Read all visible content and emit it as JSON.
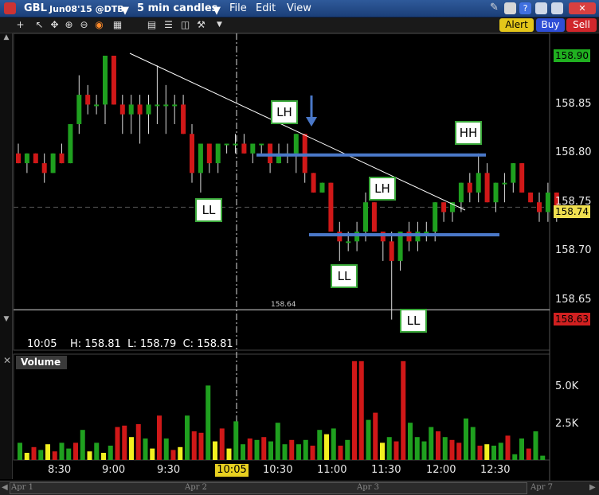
{
  "titlebar": {
    "symbol": "GBL",
    "contract": "Jun08'15 @DTB",
    "interval": "5 min candles",
    "menus": [
      "File",
      "Edit",
      "View"
    ]
  },
  "toolbar": {
    "alert_label": "Alert",
    "buy_label": "Buy",
    "sell_label": "Sell"
  },
  "price_axis": {
    "labels": [
      "158.90",
      "158.85",
      "158.80",
      "158.75",
      "158.70",
      "158.65"
    ],
    "current_price": "158.74",
    "high_tag": "158.90",
    "low_tag": "158.63",
    "level_line_label": "158.64"
  },
  "info": {
    "time": "10:05",
    "high_label": "H:",
    "high": "158.81",
    "low_label": "L:",
    "low": "158.79",
    "close_label": "C:",
    "close": "158.81"
  },
  "volume": {
    "title": "Volume",
    "axis_labels": [
      "5.0K",
      "2.5K"
    ]
  },
  "time_axis": {
    "labels": [
      "8:30",
      "9:00",
      "9:30",
      "10:30",
      "11:00",
      "11:30",
      "12:00",
      "12:30"
    ],
    "cursor_time": "10:05"
  },
  "annotations": [
    "LH",
    "LH",
    "HH",
    "LL",
    "LL",
    "LL"
  ],
  "scrollbar": {
    "dates": [
      "Apr 1",
      "Apr 2",
      "Apr 3",
      "Apr 7"
    ]
  },
  "colors": {
    "up": "#1fa01f",
    "down": "#d01818",
    "neutral_volume": "#f2f020",
    "trendline": "#ffffff",
    "levels": "#4a78c8"
  },
  "chart_data": {
    "type": "candlestick",
    "ylim": [
      158.61,
      158.92
    ],
    "candles": [
      {
        "o": 158.8,
        "h": 158.81,
        "l": 158.79,
        "c": 158.79
      },
      {
        "o": 158.79,
        "h": 158.8,
        "l": 158.78,
        "c": 158.8
      },
      {
        "o": 158.8,
        "h": 158.8,
        "l": 158.79,
        "c": 158.79
      },
      {
        "o": 158.79,
        "h": 158.8,
        "l": 158.77,
        "c": 158.78
      },
      {
        "o": 158.78,
        "h": 158.8,
        "l": 158.78,
        "c": 158.8
      },
      {
        "o": 158.8,
        "h": 158.81,
        "l": 158.79,
        "c": 158.79
      },
      {
        "o": 158.79,
        "h": 158.83,
        "l": 158.79,
        "c": 158.83
      },
      {
        "o": 158.83,
        "h": 158.88,
        "l": 158.82,
        "c": 158.86
      },
      {
        "o": 158.86,
        "h": 158.87,
        "l": 158.84,
        "c": 158.85
      },
      {
        "o": 158.85,
        "h": 158.86,
        "l": 158.84,
        "c": 158.85
      },
      {
        "o": 158.85,
        "h": 158.9,
        "l": 158.83,
        "c": 158.9
      },
      {
        "o": 158.9,
        "h": 158.9,
        "l": 158.85,
        "c": 158.85
      },
      {
        "o": 158.85,
        "h": 158.86,
        "l": 158.82,
        "c": 158.84
      },
      {
        "o": 158.84,
        "h": 158.86,
        "l": 158.82,
        "c": 158.85
      },
      {
        "o": 158.85,
        "h": 158.86,
        "l": 158.81,
        "c": 158.84
      },
      {
        "o": 158.84,
        "h": 158.86,
        "l": 158.82,
        "c": 158.85
      },
      {
        "o": 158.85,
        "h": 158.89,
        "l": 158.83,
        "c": 158.85
      },
      {
        "o": 158.85,
        "h": 158.87,
        "l": 158.82,
        "c": 158.85
      },
      {
        "o": 158.85,
        "h": 158.86,
        "l": 158.83,
        "c": 158.85
      },
      {
        "o": 158.85,
        "h": 158.86,
        "l": 158.82,
        "c": 158.82
      },
      {
        "o": 158.82,
        "h": 158.83,
        "l": 158.77,
        "c": 158.78
      },
      {
        "o": 158.78,
        "h": 158.81,
        "l": 158.76,
        "c": 158.81
      },
      {
        "o": 158.81,
        "h": 158.81,
        "l": 158.78,
        "c": 158.79
      },
      {
        "o": 158.79,
        "h": 158.81,
        "l": 158.78,
        "c": 158.81
      },
      {
        "o": 158.81,
        "h": 158.81,
        "l": 158.8,
        "c": 158.81
      },
      {
        "o": 158.81,
        "h": 158.82,
        "l": 158.8,
        "c": 158.81
      },
      {
        "o": 158.81,
        "h": 158.82,
        "l": 158.8,
        "c": 158.8
      },
      {
        "o": 158.8,
        "h": 158.81,
        "l": 158.79,
        "c": 158.81
      },
      {
        "o": 158.81,
        "h": 158.81,
        "l": 158.8,
        "c": 158.81
      },
      {
        "o": 158.81,
        "h": 158.81,
        "l": 158.78,
        "c": 158.79
      },
      {
        "o": 158.79,
        "h": 158.81,
        "l": 158.79,
        "c": 158.8
      },
      {
        "o": 158.8,
        "h": 158.81,
        "l": 158.79,
        "c": 158.8
      },
      {
        "o": 158.8,
        "h": 158.82,
        "l": 158.78,
        "c": 158.82
      },
      {
        "o": 158.82,
        "h": 158.82,
        "l": 158.77,
        "c": 158.78
      },
      {
        "o": 158.78,
        "h": 158.78,
        "l": 158.76,
        "c": 158.76
      },
      {
        "o": 158.76,
        "h": 158.77,
        "l": 158.76,
        "c": 158.77
      },
      {
        "o": 158.77,
        "h": 158.77,
        "l": 158.72,
        "c": 158.72
      },
      {
        "o": 158.72,
        "h": 158.73,
        "l": 158.69,
        "c": 158.71
      },
      {
        "o": 158.71,
        "h": 158.72,
        "l": 158.7,
        "c": 158.71
      },
      {
        "o": 158.71,
        "h": 158.73,
        "l": 158.7,
        "c": 158.72
      },
      {
        "o": 158.72,
        "h": 158.76,
        "l": 158.71,
        "c": 158.75
      },
      {
        "o": 158.75,
        "h": 158.75,
        "l": 158.72,
        "c": 158.72
      },
      {
        "o": 158.72,
        "h": 158.72,
        "l": 158.69,
        "c": 158.71
      },
      {
        "o": 158.71,
        "h": 158.72,
        "l": 158.63,
        "c": 158.69
      },
      {
        "o": 158.69,
        "h": 158.72,
        "l": 158.68,
        "c": 158.72
      },
      {
        "o": 158.72,
        "h": 158.73,
        "l": 158.7,
        "c": 158.71
      },
      {
        "o": 158.71,
        "h": 158.73,
        "l": 158.7,
        "c": 158.72
      },
      {
        "o": 158.72,
        "h": 158.73,
        "l": 158.71,
        "c": 158.72
      },
      {
        "o": 158.72,
        "h": 158.75,
        "l": 158.71,
        "c": 158.75
      },
      {
        "o": 158.75,
        "h": 158.75,
        "l": 158.73,
        "c": 158.74
      },
      {
        "o": 158.74,
        "h": 158.75,
        "l": 158.73,
        "c": 158.75
      },
      {
        "o": 158.75,
        "h": 158.77,
        "l": 158.74,
        "c": 158.77
      },
      {
        "o": 158.77,
        "h": 158.78,
        "l": 158.75,
        "c": 158.76
      },
      {
        "o": 158.76,
        "h": 158.8,
        "l": 158.75,
        "c": 158.78
      },
      {
        "o": 158.78,
        "h": 158.79,
        "l": 158.75,
        "c": 158.75
      },
      {
        "o": 158.75,
        "h": 158.77,
        "l": 158.74,
        "c": 158.77
      },
      {
        "o": 158.77,
        "h": 158.78,
        "l": 158.75,
        "c": 158.77
      },
      {
        "o": 158.77,
        "h": 158.79,
        "l": 158.76,
        "c": 158.79
      },
      {
        "o": 158.79,
        "h": 158.79,
        "l": 158.76,
        "c": 158.76
      },
      {
        "o": 158.76,
        "h": 158.76,
        "l": 158.75,
        "c": 158.75
      },
      {
        "o": 158.75,
        "h": 158.76,
        "l": 158.73,
        "c": 158.74
      },
      {
        "o": 158.74,
        "h": 158.77,
        "l": 158.73,
        "c": 158.76
      },
      {
        "o": 158.76,
        "h": 158.76,
        "l": 158.73,
        "c": 158.74
      }
    ],
    "volume": [
      1.2,
      0.5,
      0.9,
      0.7,
      1.1,
      0.6,
      1.2,
      0.8,
      1.2,
      2.1,
      0.6,
      1.2,
      0.5,
      1.0,
      2.3,
      2.4,
      1.6,
      2.5,
      1.5,
      0.8,
      3.1,
      1.5,
      0.7,
      0.9,
      3.1,
      2.0,
      1.9,
      5.2,
      1.3,
      2.2,
      0.8,
      2.7,
      1.1,
      1.5,
      1.4,
      1.6,
      1.3,
      2.6,
      1.1,
      1.4,
      1.1,
      1.4,
      1.0,
      2.1,
      1.8,
      2.2,
      1.0,
      1.4,
      6.9,
      6.9,
      2.8,
      3.3,
      1.2,
      1.6,
      1.3,
      6.9,
      2.6,
      1.6,
      1.3,
      2.3,
      2.0,
      1.6,
      1.4,
      1.2,
      2.9,
      2.3,
      1.0,
      1.1,
      1.0,
      1.2,
      1.7,
      0.4,
      1.5,
      0.8,
      2.0,
      0.3
    ],
    "volume_colors": [
      "g",
      "y",
      "r",
      "g",
      "y",
      "r",
      "g",
      "g",
      "r",
      "g",
      "y",
      "g",
      "y",
      "g",
      "r",
      "r",
      "y",
      "r",
      "g",
      "y",
      "r",
      "g",
      "r",
      "y",
      "g",
      "r",
      "r",
      "g",
      "y",
      "r",
      "y",
      "g",
      "g",
      "r",
      "g",
      "r",
      "g",
      "g",
      "g",
      "r",
      "g",
      "g",
      "r",
      "g",
      "y",
      "g",
      "r",
      "g",
      "r",
      "r",
      "g",
      "r",
      "y",
      "g",
      "r",
      "r",
      "g",
      "g",
      "g",
      "g",
      "r",
      "g",
      "r",
      "r",
      "g",
      "g",
      "r",
      "y",
      "g",
      "g",
      "r",
      "g",
      "g",
      "r",
      "g",
      "g"
    ],
    "levels": [
      158.8,
      158.716
    ],
    "current_level": 158.64
  }
}
